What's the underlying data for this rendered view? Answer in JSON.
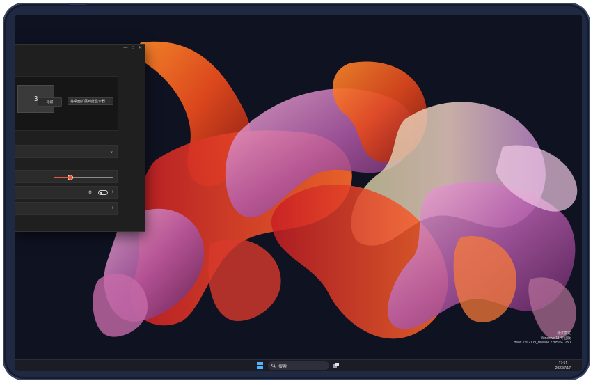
{
  "window": {
    "controls": [
      "—",
      "□",
      "✕"
    ],
    "monitor_number": "3",
    "identify_label": "标识",
    "extend_select_value": "将桌面扩展到此显示器",
    "toggle_text": "关",
    "brightness_level": 0.28
  },
  "watermark": {
    "line1": "测试模式",
    "line2": "Windows 11 专业版",
    "line3": "Build 22621.ni_release.220506-1250"
  },
  "taskbar": {
    "search_placeholder": "搜索",
    "time": "17:51",
    "date": "2023/7/17"
  },
  "colors": {
    "accent": "#e05a3a",
    "device_frame": "#1f2942",
    "windows_blue": "#4fb3ff"
  }
}
